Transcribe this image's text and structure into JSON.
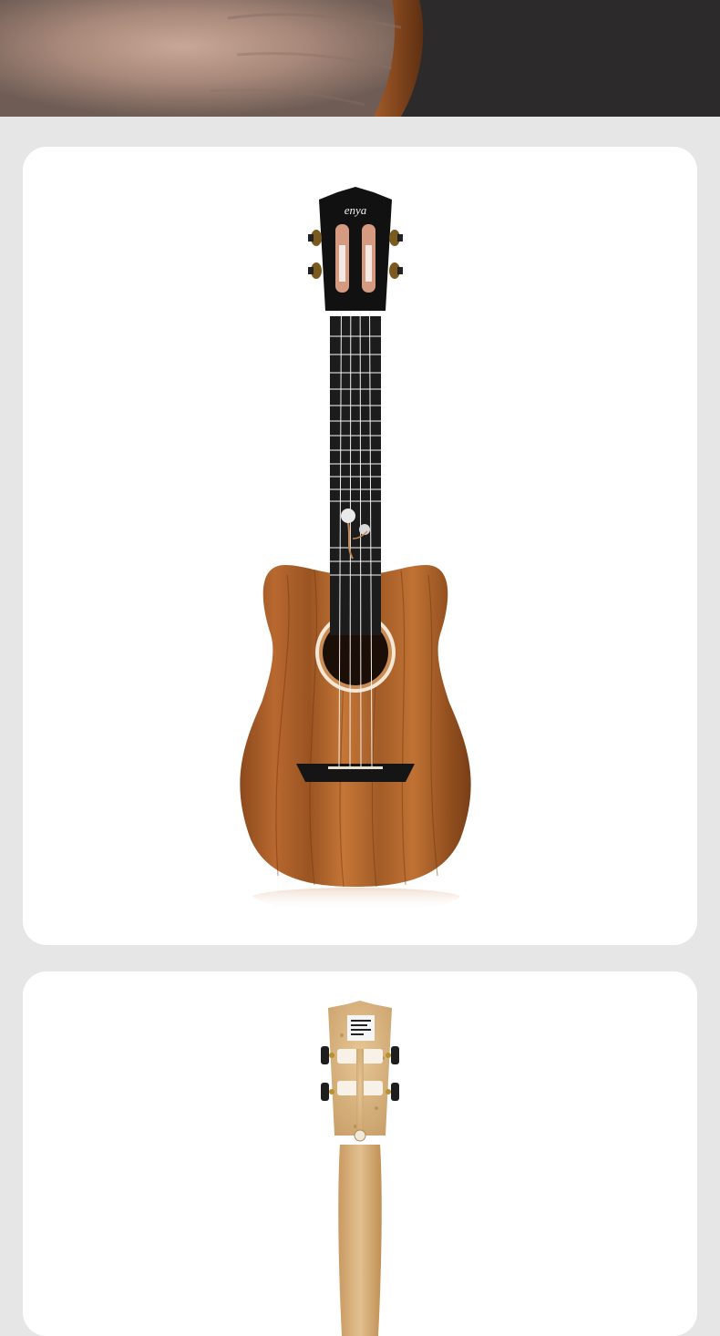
{
  "hero": {
    "image": "hand-holding-instrument-photo"
  },
  "cards": [
    {
      "image": "ukulele-front-photo",
      "headstock_logo": "enya"
    },
    {
      "image": "ukulele-back-photo"
    }
  ],
  "colors": {
    "page_background": "#e6e6e6",
    "card_background": "#ffffff",
    "koa_wood": "#b8682f",
    "fretboard": "#1c1c1c"
  }
}
